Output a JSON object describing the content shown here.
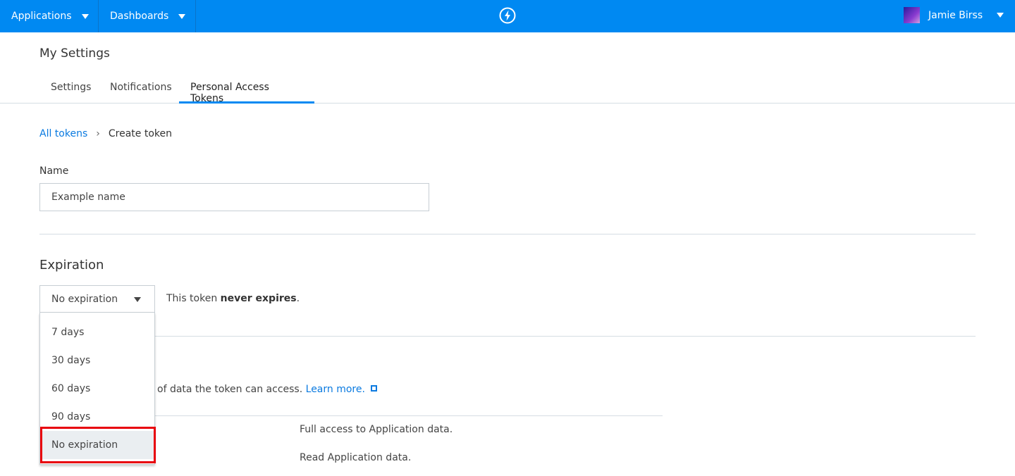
{
  "topbar": {
    "applications": "Applications",
    "dashboards": "Dashboards",
    "logo_icon": "lightning-bolt-icon",
    "user_name": "Jamie Birss"
  },
  "page": {
    "title": "My Settings"
  },
  "tabs": [
    {
      "label": "Settings"
    },
    {
      "label": "Notifications"
    },
    {
      "label": "Personal Access Tokens",
      "active": true
    }
  ],
  "breadcrumb": {
    "parent": "All tokens",
    "current": "Create token"
  },
  "name_field": {
    "label": "Name",
    "value": "Example name"
  },
  "expiration": {
    "heading": "Expiration",
    "selected": "No expiration",
    "hint_prefix": "This token ",
    "hint_bold": "never expires",
    "hint_suffix": ".",
    "options": [
      "7 days",
      "30 days",
      "60 days",
      "90 days",
      "No expiration"
    ]
  },
  "scope": {
    "description": "of data the token can access.",
    "learn_more": "Learn more.",
    "rows": [
      "Full access to Application data.",
      "Read Application data."
    ]
  },
  "colors": {
    "accent": "#0089f2",
    "highlight": "#e8000b"
  }
}
